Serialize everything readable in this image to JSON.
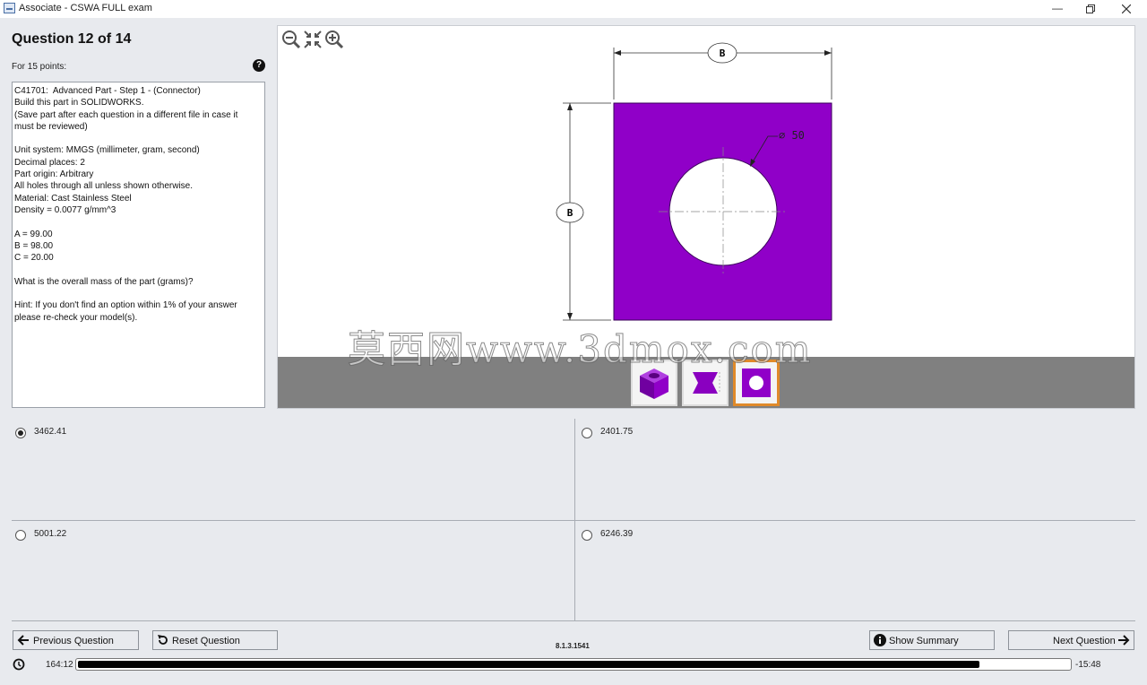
{
  "window": {
    "title": "Associate - CSWA FULL exam",
    "controls": [
      "minimize-icon",
      "restore-icon",
      "close-icon"
    ]
  },
  "question": {
    "title": "Question 12 of 14",
    "points": "For 15 points:",
    "help_icon": "question-circle-icon",
    "description_lines": [
      "C41701:  Advanced Part - Step 1 - (Connector)",
      "Build this part in SOLIDWORKS.",
      "(Save part after each question in a different file in case it",
      "must be reviewed)",
      "",
      "Unit system: MMGS (millimeter, gram, second)",
      "Decimal places: 2",
      "Part origin: Arbitrary",
      "All holes through all unless shown otherwise.",
      "Material: Cast Stainless Steel",
      "Density = 0.0077 g/mm^3",
      "",
      "A = 99.00",
      "B = 98.00",
      "C = 20.00",
      "",
      "What is the overall mass of the part (grams)?",
      "",
      "Hint: If you don't find an option within 1% of your answer",
      "please re-check your model(s)."
    ]
  },
  "viewer": {
    "toolbar": [
      "zoom-out-icon",
      "fit-icon",
      "zoom-in-icon"
    ],
    "drawing": {
      "dim_top": "B",
      "dim_left": "B",
      "hole_label": "∅ 50",
      "part_color": "#9000c8"
    },
    "thumbnails": [
      {
        "name": "isometric-view",
        "selected": false
      },
      {
        "name": "front-view",
        "selected": false
      },
      {
        "name": "top-view",
        "selected": true
      }
    ],
    "watermark": "莫西网www.3dmox.com"
  },
  "answers": [
    {
      "label": "3462.41",
      "selected": true
    },
    {
      "label": "2401.75",
      "selected": false
    },
    {
      "label": "5001.22",
      "selected": false
    },
    {
      "label": "6246.39",
      "selected": false
    }
  ],
  "footer": {
    "previous_label": "Previous Question",
    "reset_label": "Reset Question",
    "summary_label": "Show Summary",
    "next_label": "Next Question",
    "version": "8.1.3.1541",
    "time_elapsed": "164:12",
    "time_remaining": "-15:48",
    "progress_fraction": 0.91
  },
  "colors": {
    "accent_selected": "#e08a2a",
    "part": "#9000c8",
    "thumb_strip": "#808080"
  }
}
